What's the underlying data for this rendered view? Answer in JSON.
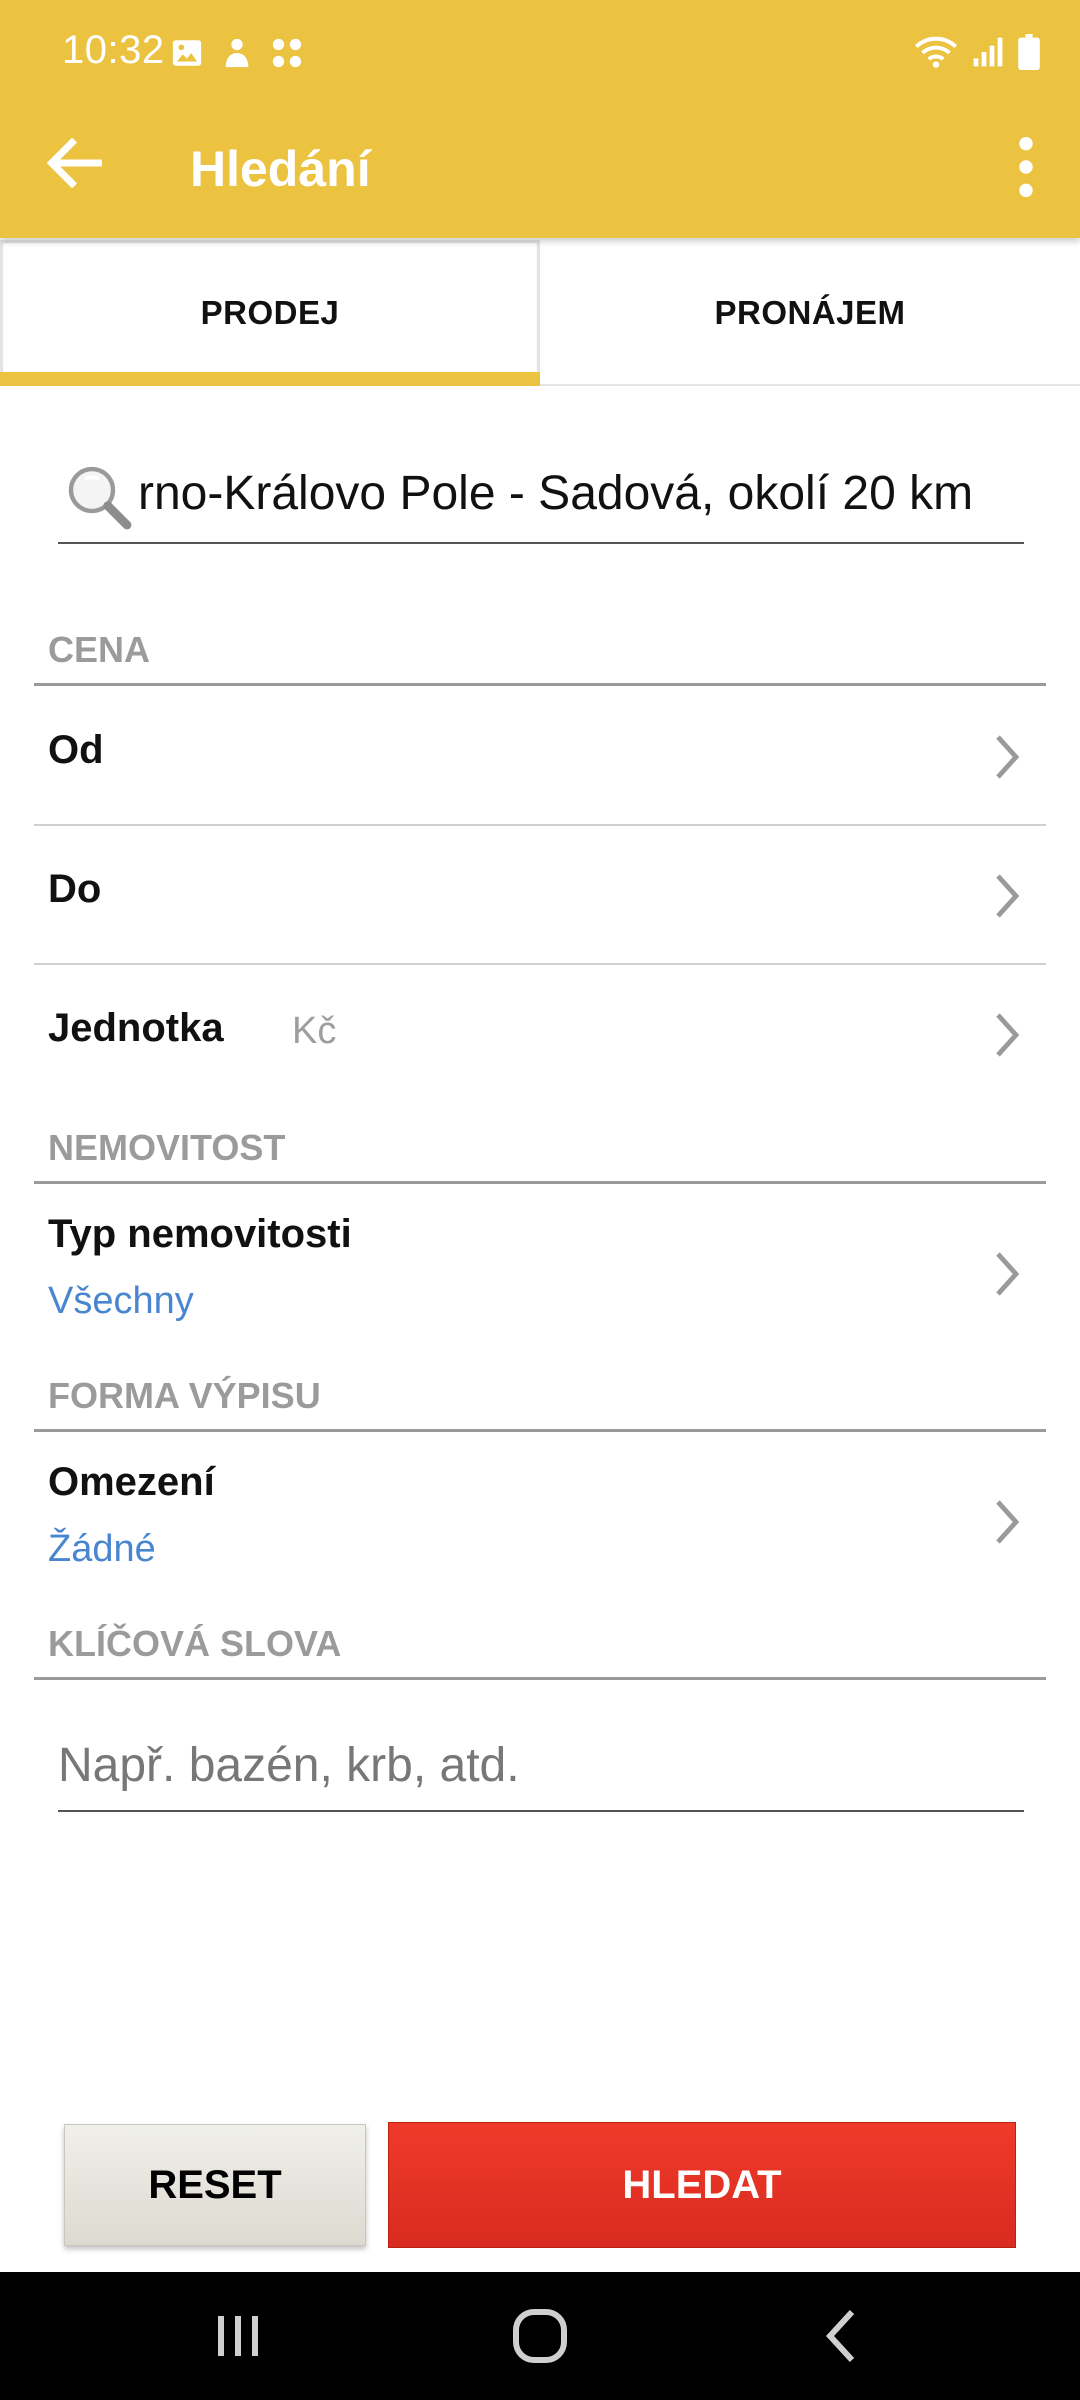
{
  "status_bar": {
    "time": "10:32",
    "icons_left": [
      "image-icon",
      "hand-icon",
      "apps-icon"
    ],
    "icons_right": [
      "wifi-icon",
      "signal-icon",
      "battery-icon"
    ]
  },
  "app_bar": {
    "title": "Hledání",
    "back_icon": "arrow-left-icon",
    "menu_icon": "more-vertical-icon"
  },
  "tabs": [
    {
      "label": "PRODEJ",
      "active": true
    },
    {
      "label": "PRONÁJEM",
      "active": false
    }
  ],
  "location": {
    "value": "rno-Královo Pole - Sadová, okolí 20 km"
  },
  "sections": {
    "price": {
      "header": "CENA",
      "from_label": "Od",
      "to_label": "Do",
      "unit_label": "Jednotka",
      "unit_value": "Kč"
    },
    "property": {
      "header": "NEMOVITOST",
      "type_label": "Typ nemovitosti",
      "type_value": "Všechny"
    },
    "listing_form": {
      "header": "FORMA VÝPISU",
      "restriction_label": "Omezení",
      "restriction_value": "Žádné"
    },
    "keywords": {
      "header": "KLÍČOVÁ SLOVA",
      "value": "",
      "placeholder": "Např. bazén, krb, atd."
    }
  },
  "buttons": {
    "reset_label": "RESET",
    "search_label": "HLEDAT"
  },
  "colors": {
    "app_bar": "#ECC241",
    "accent_blue": "#4A86D0",
    "search_button": "#E5362A"
  }
}
